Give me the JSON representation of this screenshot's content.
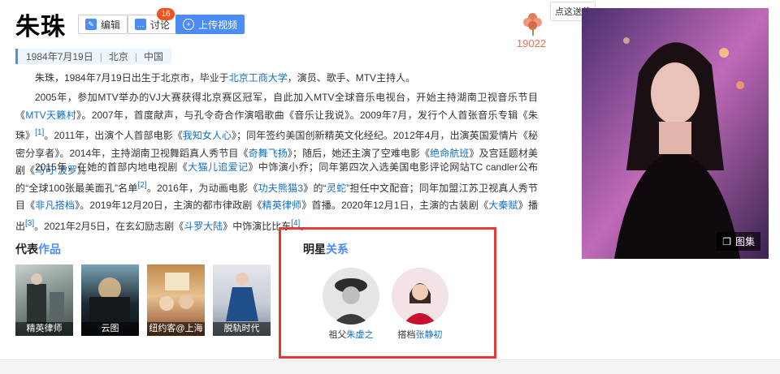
{
  "header": {
    "title": "朱珠",
    "edit_label": "编辑",
    "discuss_label": "讨论",
    "discuss_count": "16",
    "upload_label": "上传视频"
  },
  "flower": {
    "count": "19022",
    "tooltip": "点这送花"
  },
  "meta": {
    "birth": "1984年7月19日",
    "city": "北京",
    "country": "中国"
  },
  "intro": {
    "text_a": "朱珠，1984年7月19日出生于北京市，毕业于",
    "link_a": "北京工商大学",
    "text_b": "，演员、歌手、MTV主持人。"
  },
  "p2": {
    "t1": "2005年，参加MTV举办的VJ大赛获得北京赛区冠军，自此加入MTV全球音乐电视台，开始主持湖南卫视音乐节目《",
    "l1": "MTV天籁村",
    "t2": "》。2007年，首度献声，与孔令奇合作演唱歌曲《音乐让我说》。2009年7月，发行个人首张音乐专辑《朱珠》",
    "s1": "[1]",
    "t3": "。2011年，出演个人首部电影《",
    "l2": "我知女人心",
    "t4": "》；同年签约美国创新精英文化经纪。2012年4月，出演英国爱情片《秘密分享者》。2014年，主持湖南卫视舞蹈真人秀节目《",
    "l3": "奇舞飞扬",
    "t5": "》；随后，她还主演了空难电影《",
    "l4": "绝命航班",
    "t6": "》及宫廷题材美剧《",
    "l5": "马可·波罗",
    "t7": "》。"
  },
  "p3": {
    "t1": "2015年，在她的首部内地电视剧《",
    "l1": "大猫儿追爱记",
    "t2": "》中饰演小乔；同年第四次入选美国电影评论网站TC candler公布的“全球100张最美面孔”名单",
    "s1": "[2]",
    "t3": "。2016年，为动画电影《",
    "l2": "功夫熊猫3",
    "t4": "》的“",
    "l3": "灵蛇",
    "t5": "”担任中文配音；同年加盟江苏卫视真人秀节目《",
    "l4": "非凡搭档",
    "t6": "》。2019年12月20日，主演的都市律政剧《",
    "l5": "精英律师",
    "t7": "》首播。2020年12月1日，主演的古装剧《",
    "l6": "大秦赋",
    "t8": "》播出",
    "s2": "[3]",
    "t9": "。2021年2月5日，在玄幻励志剧《",
    "l7": "斗罗大陆",
    "t10": "》中饰演比比东",
    "s3": "[4]",
    "t11": "。"
  },
  "works_section": {
    "title_a": "代表",
    "title_b": "作品",
    "items": [
      {
        "label": "精英律师"
      },
      {
        "label": "云图"
      },
      {
        "label": "纽约客@上海"
      },
      {
        "label": "脱轨时代"
      }
    ]
  },
  "relations_section": {
    "title_a": "明星",
    "title_b": "关系",
    "items": [
      {
        "relation": "祖父",
        "name": "朱虚之"
      },
      {
        "relation": "搭档",
        "name": "张静初"
      }
    ]
  },
  "photo": {
    "album_label": "图集"
  },
  "colors": {
    "accent": "#4c8cf5",
    "link": "#136ec2",
    "highlight_box": "#e53935",
    "flower": "#e0724e"
  }
}
